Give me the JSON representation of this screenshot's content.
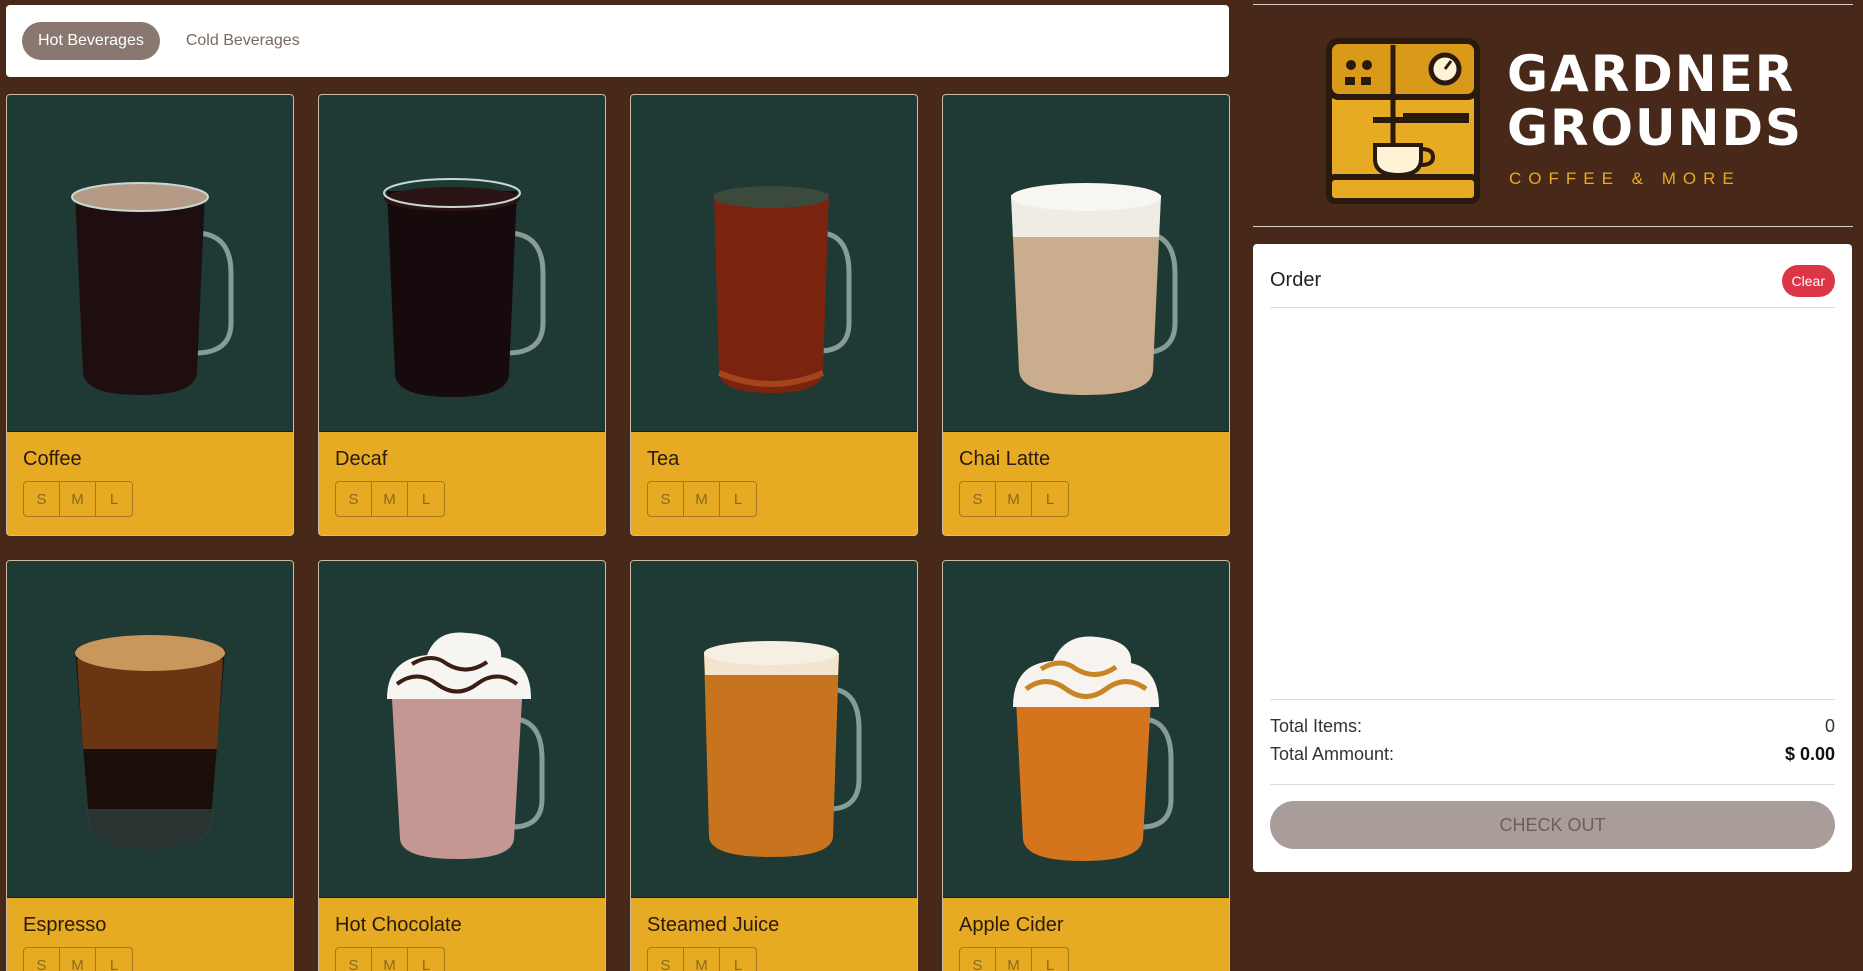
{
  "tabs": [
    {
      "label": "Hot Beverages",
      "active": true
    },
    {
      "label": "Cold Beverages",
      "active": false
    }
  ],
  "sizes": [
    "S",
    "M",
    "L"
  ],
  "products": [
    {
      "name": "Coffee",
      "drink": "coffee"
    },
    {
      "name": "Decaf",
      "drink": "decaf"
    },
    {
      "name": "Tea",
      "drink": "tea"
    },
    {
      "name": "Chai Latte",
      "drink": "chai"
    },
    {
      "name": "Espresso",
      "drink": "espresso"
    },
    {
      "name": "Hot Chocolate",
      "drink": "hot-chocolate"
    },
    {
      "name": "Steamed Juice",
      "drink": "steamed-juice"
    },
    {
      "name": "Apple Cider",
      "drink": "apple-cider"
    }
  ],
  "brand": {
    "name_line1": "GARDNER",
    "name_line2": "GROUNDS",
    "tagline": "COFFEE & MORE"
  },
  "order": {
    "title": "Order",
    "clear_label": "Clear",
    "total_items_label": "Total Items:",
    "total_items_value": "0",
    "total_amount_label": "Total Ammount:",
    "total_amount_value": "$ 0.00",
    "checkout_label": "CHECK OUT"
  },
  "colors": {
    "background": "#472819",
    "card_body": "#e6ab22",
    "card_image_bg": "#1f3a35",
    "tab_active": "#8a7870",
    "clear": "#dc3545",
    "checkout": "#a89d98",
    "brand_accent": "#e6ab22"
  }
}
